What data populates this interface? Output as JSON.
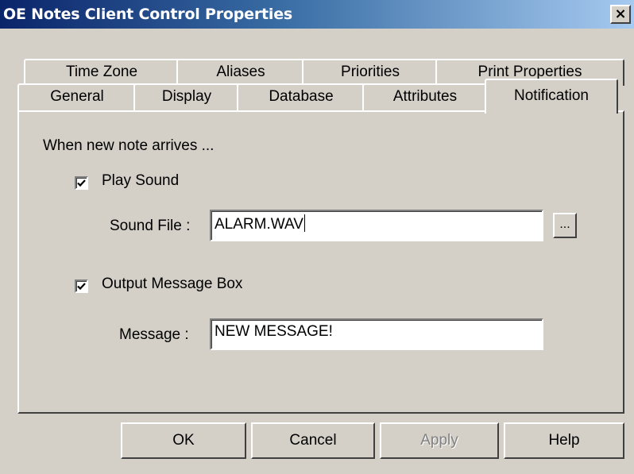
{
  "window": {
    "title": "OE Notes Client Control Properties",
    "close_label": "×"
  },
  "tabs": {
    "row_back": [
      "Time Zone",
      "Aliases",
      "Priorities",
      "Print Properties"
    ],
    "row_front": [
      "General",
      "Display",
      "Database",
      "Attributes",
      "Notification"
    ],
    "active": "Notification"
  },
  "notification": {
    "heading": "When new note arrives ...",
    "play_sound": {
      "label": "Play Sound",
      "checked": true
    },
    "sound_file": {
      "label": "Sound File :",
      "value": "ALARM.WAV",
      "browse_label": "..."
    },
    "output_message_box": {
      "label": "Output Message Box",
      "checked": true
    },
    "message": {
      "label": "Message :",
      "value": "NEW MESSAGE!"
    }
  },
  "buttons": {
    "ok": "OK",
    "cancel": "Cancel",
    "apply": "Apply",
    "help": "Help"
  },
  "colors": {
    "face": "#d4d0c8",
    "title_start": "#0a246a",
    "title_end": "#a6caf0"
  }
}
